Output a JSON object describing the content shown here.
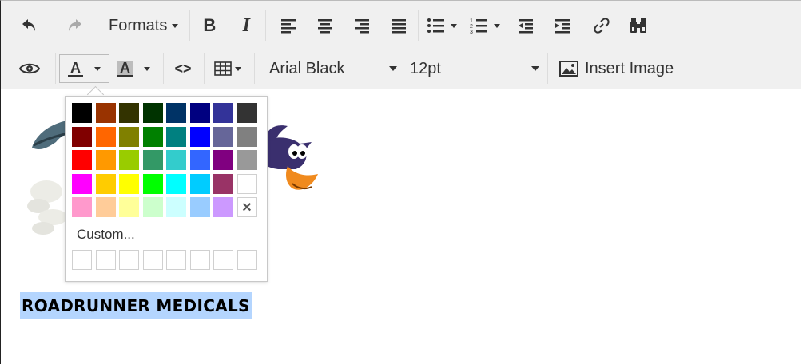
{
  "toolbar": {
    "formats_label": "Formats",
    "bold_label": "B",
    "italic_label": "I",
    "font_family": "Arial Black",
    "font_size": "12pt",
    "insert_image_label": "Insert Image",
    "text_color_letter": "A",
    "bg_color_letter": "A",
    "source_code_label": "<>"
  },
  "color_picker": {
    "custom_label": "Custom...",
    "remove_label": "✕",
    "swatches": [
      [
        "#000000",
        "#993300",
        "#333300",
        "#003300",
        "#003366",
        "#000080",
        "#333399",
        "#333333"
      ],
      [
        "#800000",
        "#ff6600",
        "#808000",
        "#008000",
        "#008080",
        "#0000ff",
        "#666699",
        "#808080"
      ],
      [
        "#ff0000",
        "#ff9900",
        "#99cc00",
        "#339966",
        "#33cccc",
        "#3366ff",
        "#800080",
        "#999999"
      ],
      [
        "#ff00ff",
        "#ffcc00",
        "#ffff00",
        "#00ff00",
        "#00ffff",
        "#00ccff",
        "#993366",
        "#ffffff"
      ],
      [
        "#ff99cc",
        "#ffcc99",
        "#ffff99",
        "#ccffcc",
        "#ccffff",
        "#99ccff",
        "#cc99ff",
        ""
      ]
    ]
  },
  "content": {
    "heading": "ROADRUNNER MEDICALS"
  },
  "icons": [
    "undo-icon",
    "redo-icon",
    "align-left-icon",
    "align-center-icon",
    "align-right-icon",
    "align-justify-icon",
    "bullet-list-icon",
    "numbered-list-icon",
    "outdent-icon",
    "indent-icon",
    "link-icon",
    "find-icon",
    "preview-icon",
    "table-icon",
    "image-icon"
  ]
}
